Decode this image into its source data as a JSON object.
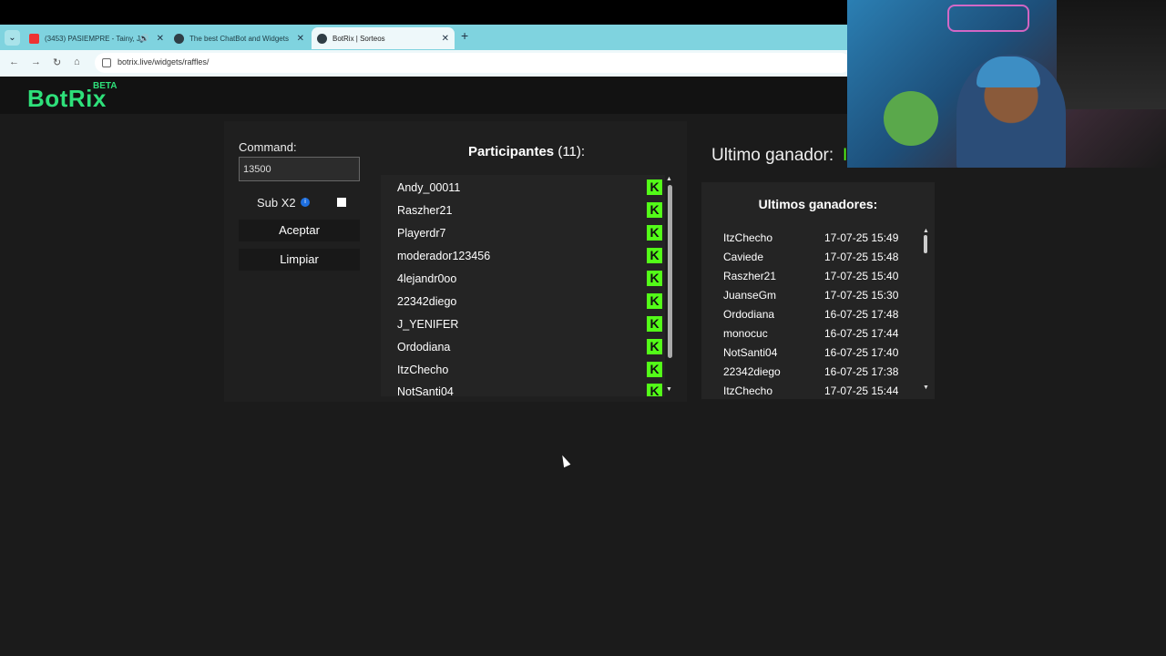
{
  "browser": {
    "tabs": [
      {
        "title": "(3453) PASIEMPRE - Tainy, J",
        "icon": "youtube-icon"
      },
      {
        "title": "The best ChatBot and Widgets",
        "icon": "botrix-icon"
      },
      {
        "title": "BotRix | Sorteos",
        "icon": "botrix-icon"
      }
    ],
    "url": "botrix.live/widgets/raffles/"
  },
  "header": {
    "logo": "BotRix",
    "badge": "BETA"
  },
  "controls": {
    "command_label": "Command:",
    "command_value": "13500",
    "sub_label": "Sub X2",
    "accept_label": "Aceptar",
    "clear_label": "Limpiar"
  },
  "participants": {
    "title": "Participantes",
    "count": "(11):",
    "items": [
      "Andy_00011",
      "Raszher21",
      "Playerdr7",
      "moderador123456",
      "4lejandr0oo",
      "22342diego",
      "J_YENIFER",
      "Ordodiana",
      "ItzChecho",
      "NotSanti04"
    ]
  },
  "winner": {
    "title": "Ultimo ganador:",
    "name_fragment": "I"
  },
  "last_winners": {
    "title": "Ultimos ganadores:",
    "items": [
      {
        "name": "ItzChecho",
        "date": "17-07-25 15:49"
      },
      {
        "name": "Caviede",
        "date": "17-07-25 15:48"
      },
      {
        "name": "Raszher21",
        "date": "17-07-25 15:40"
      },
      {
        "name": "JuanseGm",
        "date": "17-07-25 15:30"
      },
      {
        "name": "Ordodiana",
        "date": "16-07-25 17:48"
      },
      {
        "name": "monocuc",
        "date": "16-07-25 17:44"
      },
      {
        "name": "NotSanti04",
        "date": "16-07-25 17:40"
      },
      {
        "name": "22342diego",
        "date": "16-07-25 17:38"
      },
      {
        "name": "ItzChecho",
        "date": "17-07-25 15:44"
      }
    ]
  },
  "colors": {
    "accent": "#2ee07a",
    "kick": "#53fc18",
    "tabbar": "#7fd3df"
  }
}
